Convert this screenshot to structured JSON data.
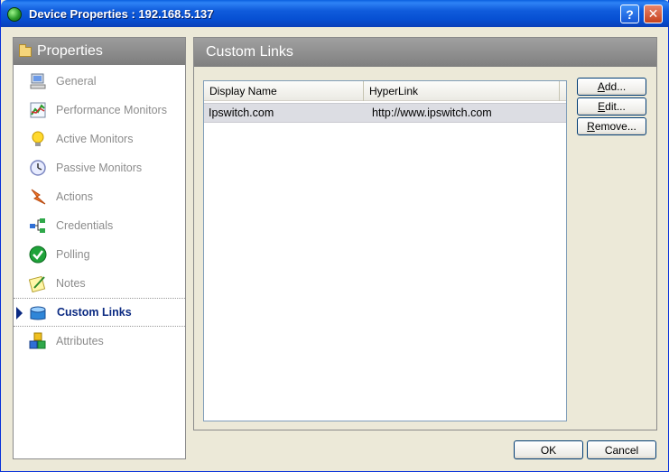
{
  "window": {
    "title": "Device Properties : 192.168.5.137",
    "help_button": "?",
    "close_button": "✕"
  },
  "sidebar": {
    "header": "Properties",
    "items": [
      {
        "label": "General",
        "icon": "computer-icon"
      },
      {
        "label": "Performance Monitors",
        "icon": "chart-icon"
      },
      {
        "label": "Active Monitors",
        "icon": "lightbulb-icon"
      },
      {
        "label": "Passive Monitors",
        "icon": "clock-icon"
      },
      {
        "label": "Actions",
        "icon": "lightning-icon"
      },
      {
        "label": "Credentials",
        "icon": "network-icon"
      },
      {
        "label": "Polling",
        "icon": "checkmark-icon"
      },
      {
        "label": "Notes",
        "icon": "notepad-icon"
      },
      {
        "label": "Custom Links",
        "icon": "link-box-icon",
        "selected": true
      },
      {
        "label": "Attributes",
        "icon": "cubes-icon"
      }
    ]
  },
  "main": {
    "header": "Custom Links",
    "list": {
      "columns": [
        "Display Name",
        "HyperLink"
      ],
      "rows": [
        [
          "Ipswitch.com",
          "http://www.ipswitch.com"
        ]
      ]
    },
    "buttons": {
      "add_prefix": "",
      "add_u": "A",
      "add_rest": "dd...",
      "edit_prefix": "",
      "edit_u": "E",
      "edit_rest": "dit...",
      "remove_prefix": "",
      "remove_u": "R",
      "remove_rest": "emove..."
    }
  },
  "footer": {
    "ok_label": "OK",
    "cancel_label": "Cancel"
  }
}
